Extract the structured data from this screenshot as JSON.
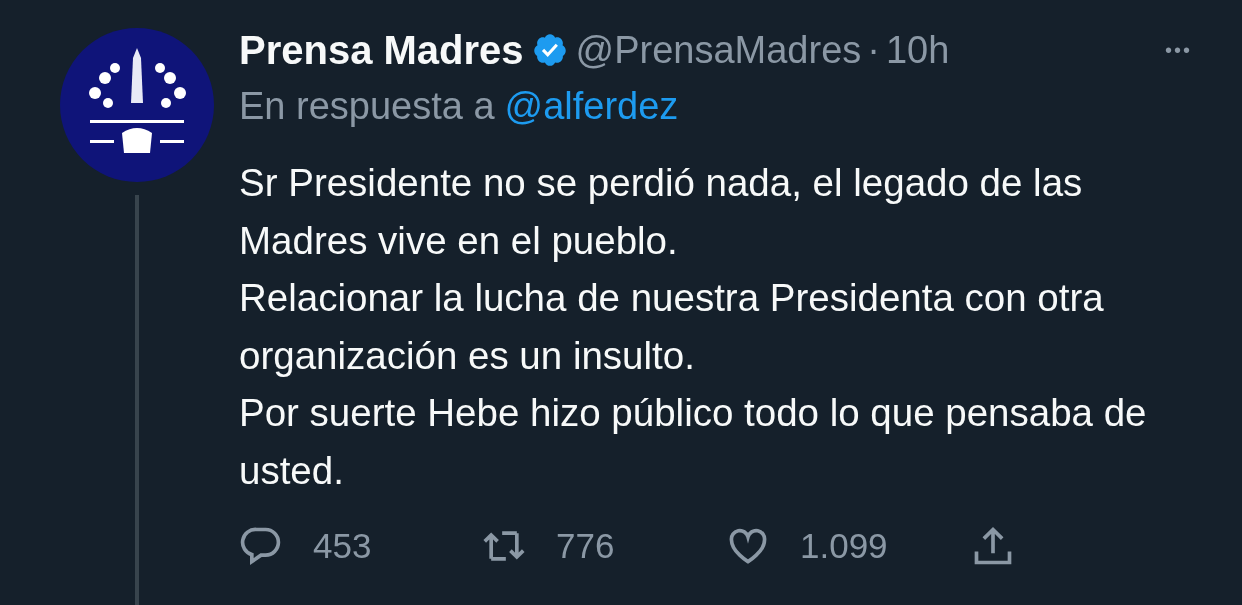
{
  "tweet": {
    "author_name": "Prensa Madres",
    "verified": true,
    "handle": "@PrensaMadres",
    "separator": "·",
    "time": "10h",
    "more": "•••",
    "reply_prefix": "En respuesta a",
    "reply_to": "@alferdez",
    "paragraphs": [
      "Sr Presidente no se perdió nada, el legado de las Madres vive en el pueblo.",
      "Relacionar la lucha de nuestra Presidenta con otra organización es un insulto.",
      "Por suerte Hebe hizo público todo lo que pensaba de usted."
    ],
    "actions": [
      {
        "kind": "reply",
        "count": "453"
      },
      {
        "kind": "retweet",
        "count": "776"
      },
      {
        "kind": "like",
        "count": "1.099"
      },
      {
        "kind": "share"
      }
    ]
  }
}
